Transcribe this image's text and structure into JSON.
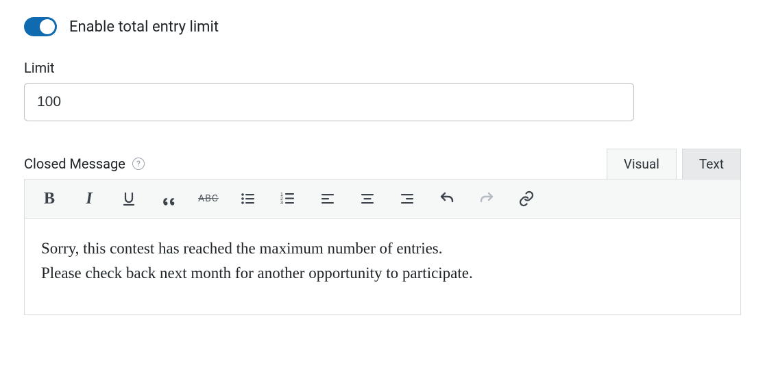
{
  "toggle": {
    "enabled": true,
    "label": "Enable total entry limit"
  },
  "limit": {
    "label": "Limit",
    "value": "100"
  },
  "closed": {
    "label": "Closed Message",
    "tabs": {
      "visual": "Visual",
      "text": "Text"
    },
    "content_line1": "Sorry, this contest has reached the maximum number of entries.",
    "content_line2": "Please check back next month for another opportunity to participate."
  }
}
